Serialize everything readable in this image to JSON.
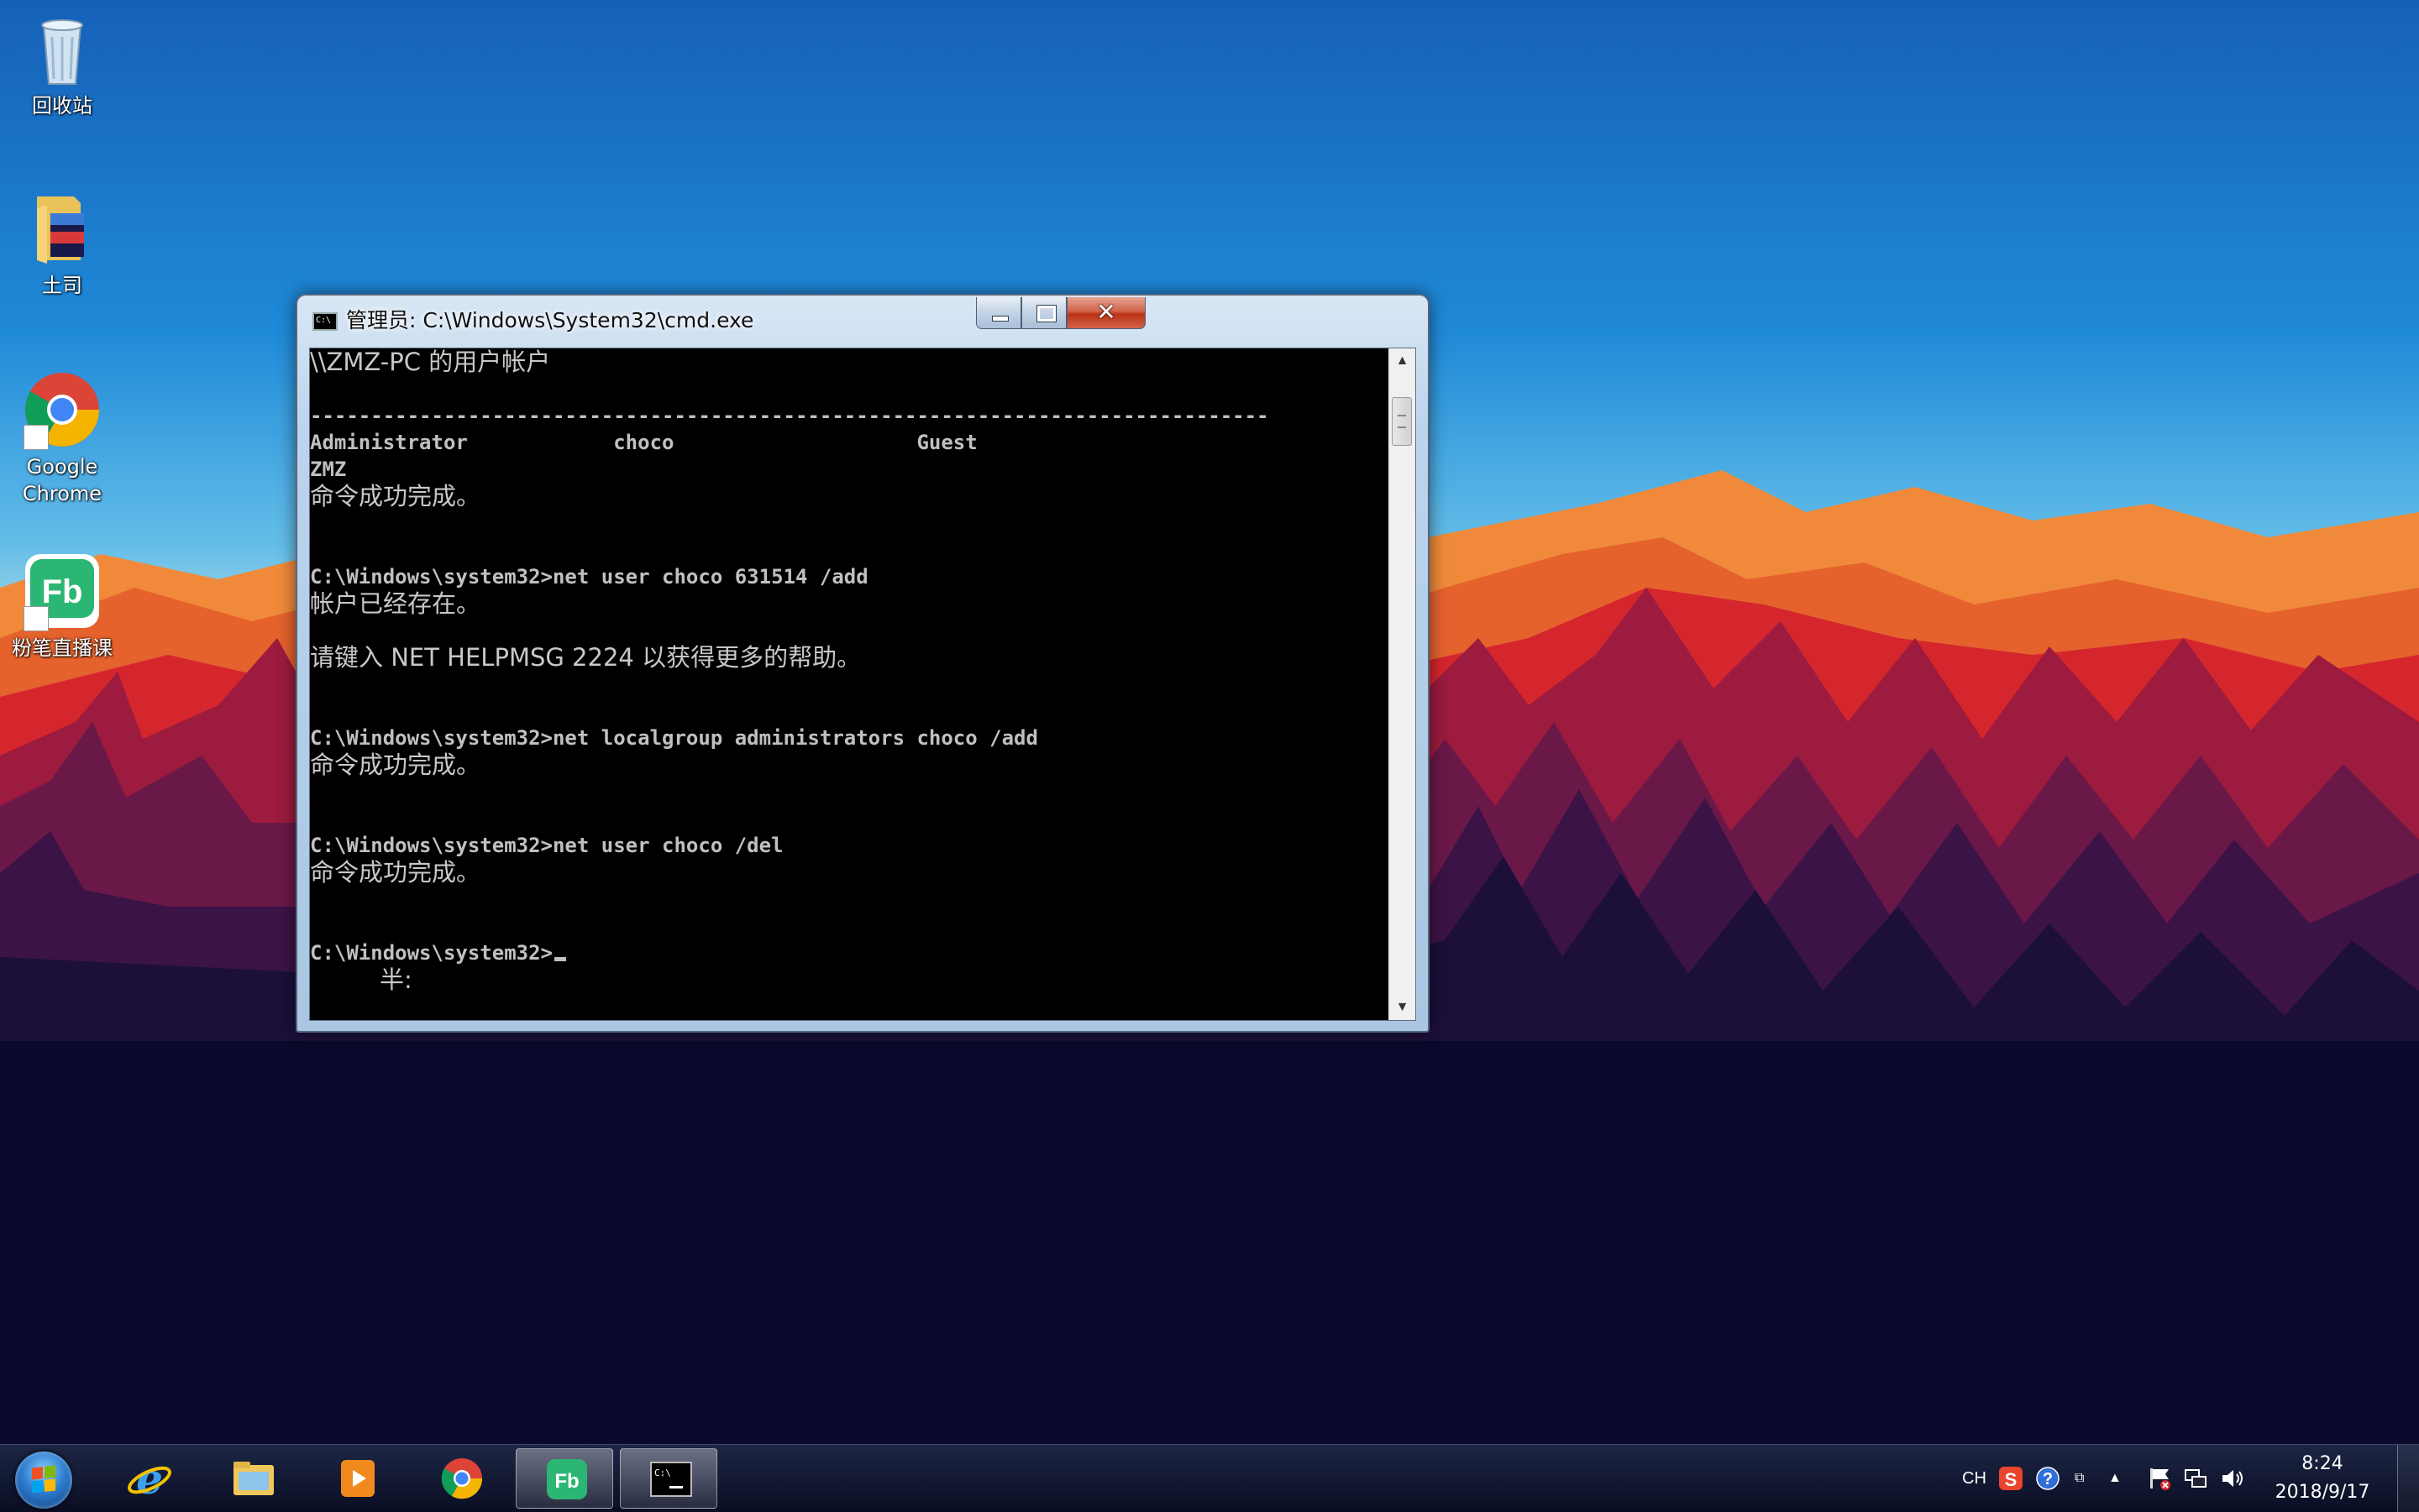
{
  "desktop": {
    "icons": [
      {
        "label": "回收站"
      },
      {
        "label": "土司"
      },
      {
        "label": "Google Chrome",
        "line1": "Google",
        "line2": "Chrome"
      },
      {
        "label": "粉笔直播课"
      }
    ]
  },
  "cmd": {
    "title": "管理员: C:\\Windows\\System32\\cmd.exe",
    "close_glyph": "✕",
    "lines": [
      "\\\\ZMZ-PC 的用户帐户",
      "",
      "-------------------------------------------------------------------------------",
      "Administrator            choco                    Guest",
      "ZMZ",
      "命令成功完成。",
      "",
      "",
      "C:\\Windows\\system32>net user choco 631514 /add",
      "帐户已经存在。",
      "",
      "请键入 NET HELPMSG 2224 以获得更多的帮助。",
      "",
      "",
      "C:\\Windows\\system32>net localgroup administrators choco /add",
      "命令成功完成。",
      "",
      "",
      "C:\\Windows\\system32>net user choco /del",
      "命令成功完成。",
      "",
      "",
      "C:\\Windows\\system32>",
      "         半:"
    ]
  },
  "taskbar": {
    "tray": {
      "lang": "CH"
    },
    "clock": {
      "time": "8:24",
      "date": "2018/9/17"
    }
  },
  "colors": {
    "console_bg": "#000000",
    "console_fg": "#c0c0c0",
    "close_red": "#c7402a"
  },
  "icons": [
    "recycle-bin-icon",
    "folder-icon",
    "chrome-icon",
    "fenbi-icon",
    "ie-icon",
    "explorer-icon",
    "media-player-icon",
    "cmd-icon",
    "sogou-icon",
    "help-icon",
    "flag-icon",
    "network-icon",
    "volume-icon"
  ]
}
